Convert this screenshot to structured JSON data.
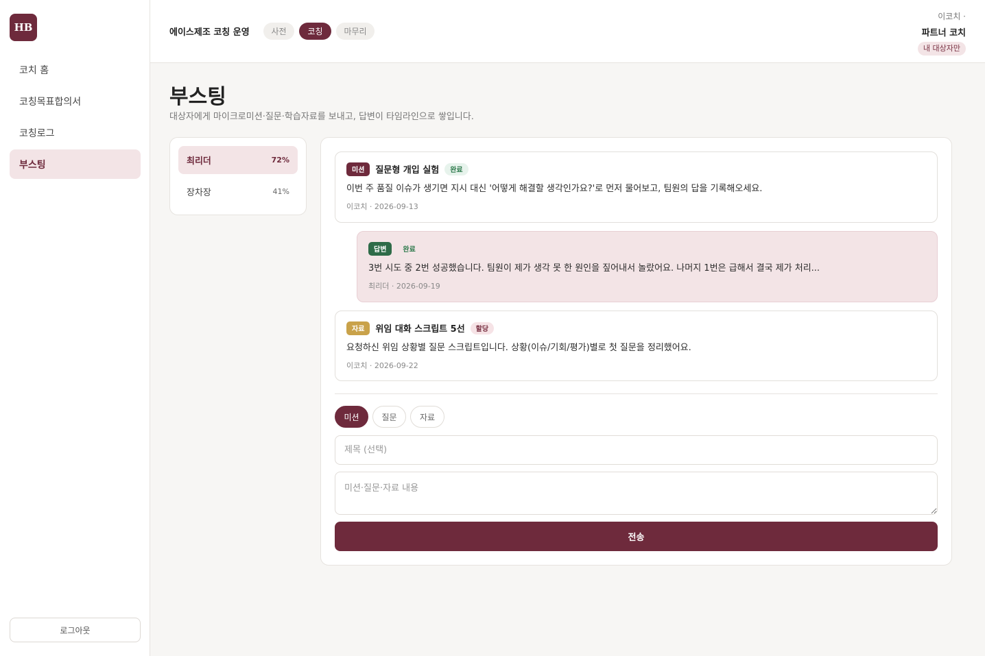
{
  "brand": {
    "logo_text": "HB",
    "accent": "#6e2a3c"
  },
  "sidebar": {
    "items": [
      {
        "label": "코치 홈"
      },
      {
        "label": "코칭목표합의서"
      },
      {
        "label": "코칭로그"
      },
      {
        "label": "부스팅"
      }
    ],
    "active_index": 3,
    "logout_label": "로그아웃"
  },
  "header": {
    "org_title": "에이스제조 코칭 운영",
    "phases": [
      "사전",
      "코칭",
      "마무리"
    ],
    "active_phase": "코칭",
    "user_line1": "이코치 ·",
    "user_line2": "파트너 코치",
    "scope_badge": "내 대상자만"
  },
  "page": {
    "title": "부스팅",
    "subtitle": "대상자에게 마이크로미션·질문·학습자료를 보내고, 답변이 타임라인으로 쌓입니다."
  },
  "targets": [
    {
      "name": "최리더",
      "progress": "72%"
    },
    {
      "name": "장차장",
      "progress": "41%"
    }
  ],
  "timeline": [
    {
      "type": "미션",
      "type_color": "#6e2a3c",
      "title": "질문형 개입 실험",
      "status": "완료",
      "body": "이번 주 품질 이슈가 생기면 지시 대신 '어떻게 해결할 생각인가요?'로 먼저 물어보고, 팀원의 답을 기록해오세요.",
      "meta": "이코치 · 2026-09-13"
    },
    {
      "type": "답변",
      "type_color": "#2e6b48",
      "status": "완료",
      "body": "3번 시도 중 2번 성공했습니다. 팀원이 제가 생각 못 한 원인을 짚어내서 놀랐어요. 나머지 1번은 급해서 결국 제가 처리...",
      "meta": "최리더 · 2026-09-19"
    },
    {
      "type": "자료",
      "type_color": "#c9a24a",
      "title": "위임 대화 스크립트 5선",
      "status": "할당",
      "body": "요청하신 위임 상황별 질문 스크립트입니다. 상황(이슈/기회/평가)별로 첫 질문을 정리했어요.",
      "meta": "이코치 · 2026-09-22"
    }
  ],
  "composer": {
    "types": [
      "미션",
      "질문",
      "자료"
    ],
    "active_type": "미션",
    "title_placeholder": "제목 (선택)",
    "body_placeholder": "미션·질문·자료 내용",
    "send_label": "전송"
  }
}
